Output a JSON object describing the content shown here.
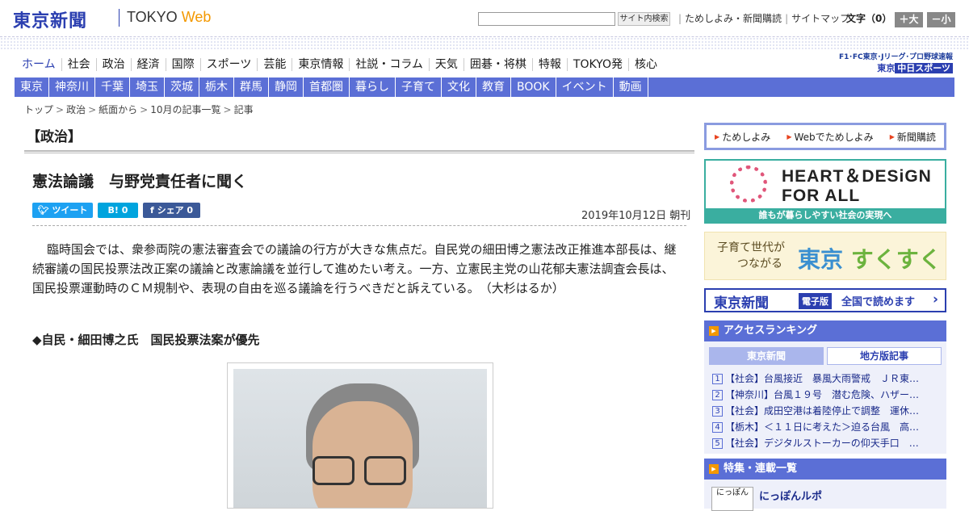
{
  "header": {
    "logo": "東京新聞",
    "logo_tokyo": "TOKYO",
    "logo_web": "Web",
    "search_placeholder": "",
    "search_button": "サイト内検索",
    "links": [
      "ためしよみ・新聞購読",
      "サイトマップ"
    ],
    "font_size_label": "文字（0）",
    "font_larger": "＋大",
    "font_smaller": "－小"
  },
  "nav_main": [
    "ホーム",
    "社会",
    "政治",
    "経済",
    "国際",
    "スポーツ",
    "芸能",
    "東京情報",
    "社説・コラム",
    "天気",
    "囲碁・将棋",
    "特報",
    "TOKYO発",
    "核心"
  ],
  "sports_link": {
    "line1": "F1･FC東京･Jリーグ･プロ野球速報",
    "line2_prefix": "東京",
    "line2_brand": "中日スポーツ"
  },
  "nav_region": [
    "東京",
    "神奈川",
    "千葉",
    "埼玉",
    "茨城",
    "栃木",
    "群馬",
    "静岡",
    "首都圏",
    "暮らし",
    "子育て",
    "文化",
    "教育",
    "BOOK",
    "イベント",
    "動画"
  ],
  "breadcrumb": [
    "トップ",
    "政治",
    "紙面から",
    "10月の記事一覧",
    "記事"
  ],
  "article": {
    "category": "【政治】",
    "title": "憲法論議　与野党責任者に聞く",
    "share": {
      "tweet": "ツイート",
      "hatena": "B! 0",
      "facebook": "シェア 0"
    },
    "date": "2019年10月12日 朝刊",
    "body": "臨時国会では、衆参両院の憲法審査会での議論の行方が大きな焦点だ。自民党の細田博之憲法改正推進本部長は、継続審議の国民投票法改正案の議論と改憲論議を並行して進めたい考え。一方、立憲民主党の山花郁夫憲法調査会長は、国民投票運動時のＣＭ規制や、表現の自由を巡る議論を行うべきだと訴えている。　（大杉はるか）",
    "subheading": "◆自民・細田博之氏　国民投票法案が優先"
  },
  "sidebar": {
    "trial": [
      "ためしよみ",
      "Webでためしよみ",
      "新聞購読"
    ],
    "heart_design": {
      "title_line1": "HEART＆DESiGN",
      "title_line2": "FOR ALL",
      "caption": "誰もが暮らしやすい社会の実現へ"
    },
    "sukusuku": {
      "line1": "子育て世代が",
      "line2": "つながる",
      "brand1": "東京",
      "brand2": "すくすく"
    },
    "e_edition": {
      "name": "東京新聞",
      "badge": "電子版",
      "text": "全国で読めます",
      "arrow": "›"
    },
    "ranking": {
      "heading": "アクセスランキング",
      "tab_active": "東京新聞",
      "tab_other": "地方版記事",
      "items": [
        {
          "num": "1",
          "text": "【社会】台風接近　暴風大雨警戒　ＪＲ東…"
        },
        {
          "num": "2",
          "text": "【神奈川】台風１９号　潜む危険、ハザー…"
        },
        {
          "num": "3",
          "text": "【社会】成田空港は着陸停止で調整　運休…"
        },
        {
          "num": "4",
          "text": "【栃木】＜１１日に考えた＞迫る台風　高…"
        },
        {
          "num": "5",
          "text": "【社会】デジタルストーカーの仰天手口　…"
        }
      ]
    },
    "features": {
      "heading": "特集・連載一覧",
      "thumb": "にっぽん",
      "item": "にっぽんルポ",
      "subtext": ""
    }
  }
}
